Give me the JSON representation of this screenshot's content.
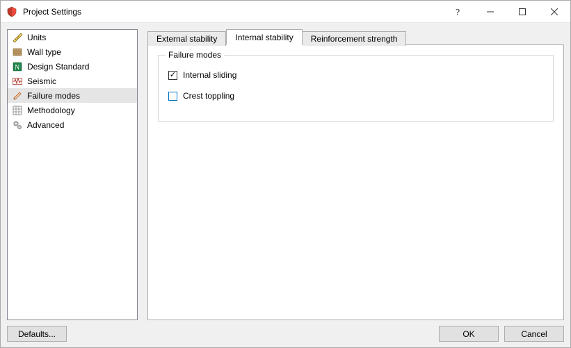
{
  "window": {
    "title": "Project Settings"
  },
  "sidebar": {
    "items": [
      {
        "label": "Units"
      },
      {
        "label": "Wall type"
      },
      {
        "label": "Design Standard"
      },
      {
        "label": "Seismic"
      },
      {
        "label": "Failure modes"
      },
      {
        "label": "Methodology"
      },
      {
        "label": "Advanced"
      }
    ],
    "selected_index": 4
  },
  "tabs": {
    "items": [
      {
        "label": "External stability"
      },
      {
        "label": "Internal stability"
      },
      {
        "label": "Reinforcement strength"
      }
    ],
    "active_index": 1
  },
  "panel": {
    "group_title": "Failure modes",
    "checkboxes": [
      {
        "label": "Internal sliding",
        "checked": true
      },
      {
        "label": "Crest toppling",
        "checked": false
      }
    ]
  },
  "buttons": {
    "defaults": "Defaults...",
    "ok": "OK",
    "cancel": "Cancel"
  }
}
